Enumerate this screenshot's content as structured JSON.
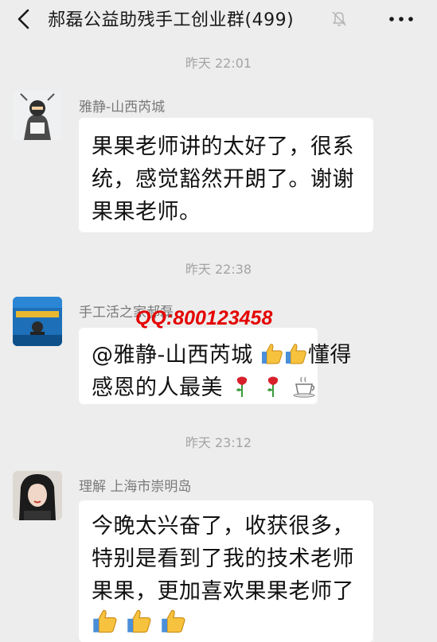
{
  "header": {
    "title": "郝磊公益助残手工创业群(499)"
  },
  "messages": [
    {
      "time": "昨天 22:01",
      "sender": "雅静-山西芮城",
      "lines": [
        "果果老师讲的太好了，很系",
        "统，感觉豁然开朗了。谢谢",
        "果果老师。"
      ]
    },
    {
      "time": "昨天 22:38",
      "sender": "手工活之家郝磊",
      "line1": "@雅静-山西芮城",
      "line1_tail": "懂得",
      "line2": "感恩的人最美"
    },
    {
      "time": "昨天 23:12",
      "sender": "理解 上海市崇明岛",
      "lines": [
        "今晚太兴奋了，收获很多，",
        "特别是看到了我的技术老师",
        "果果，更加喜欢果果老师了"
      ]
    }
  ],
  "watermark": "QQ:800123458",
  "icons": [
    "back-icon",
    "mute-icon",
    "more-icon",
    "thumbs-up-icon",
    "rose-icon",
    "coffee-icon"
  ],
  "colors": {
    "background": "#ededed",
    "bubble": "#ffffff",
    "watermark": "#e50000"
  }
}
